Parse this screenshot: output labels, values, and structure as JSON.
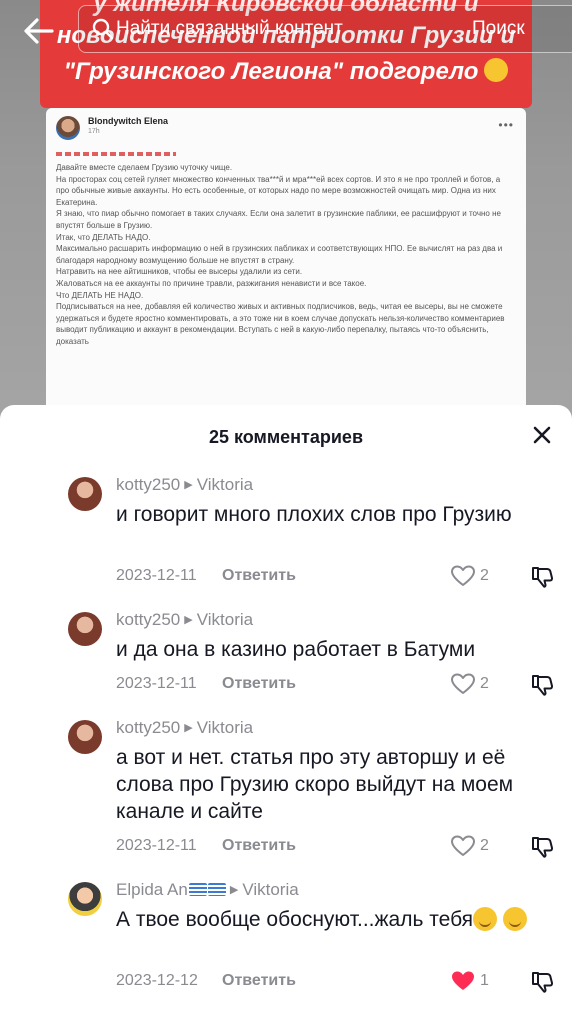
{
  "video": {
    "banner": {
      "line1": "у жителя Кировской области и",
      "line2": "новоиспеченной патриотки Грузии и",
      "line3": "\"Грузинского Легиона\" подгорело"
    },
    "post": {
      "author": "Blondywitch Elena",
      "time": "17h",
      "text": "Давайте вместе сделаем Грузию чуточку чище.\nНа просторах соц сетей гуляет множество конченных тва***й и мра***ей всех сортов. И это я не про троллей и ботов, а про обычные живые аккаунты. Но есть особенные, от которых надо по мере возможностей очищать мир. Одна из них Екатерина.\nЯ знаю, что пиар обычно помогает в таких случаях. Если она залетит в грузинские паблики, ее расшифруют и точно не впустят больше в Грузию.\nИтак, что ДЕЛАТЬ НАДО.\nМаксимально расшарить информацию о ней в грузинских пабликах и соответствующих НПО. Ее вычислят на раз два и благодаря народному возмущению больше не впустят в страну.\nНатравить на нее айтишников, чтобы ее высеры удалили из сети.\nЖаловаться на ее аккаунты по причине травли, разжигания ненависти и все такое.\nЧто ДЕЛАТЬ НЕ НАДО.\nПодписываться на нее, добавляя ей количество живых и активных подписчиков, ведь, читая ее высеры, вы не сможете удержаться и будете яростно комментировать, а это тоже ни в коем случае допускать нельзя-количество комментариев выводит публикацию и аккаунт в рекомендации. Вступать с ней в какую-либо перепалку, пытаясь что-то объяснить, доказать"
    }
  },
  "search": {
    "placeholder": "Найти связанный контент",
    "button": "Поиск"
  },
  "comments_sheet": {
    "title": "25 комментариев",
    "reply_label": "Ответить",
    "comments": [
      {
        "user": "kotty250",
        "reply_to": "Viktoria",
        "text": "и говорит много плохих слов про Грузию",
        "date": "2023-12-11",
        "likes": "2",
        "liked": false
      },
      {
        "user": "kotty250",
        "reply_to": "Viktoria",
        "text": "и да она в казино работает в Батуми",
        "date": "2023-12-11",
        "likes": "2",
        "liked": false
      },
      {
        "user": "kotty250",
        "reply_to": "Viktoria",
        "text": "а вот и нет. статья про эту авторшу и её слова про Грузию скоро выйдут на моем канале и сайте",
        "date": "2023-12-11",
        "likes": "2",
        "liked": false
      },
      {
        "user": "Elpida An",
        "reply_to": "Viktoria",
        "text": "А твое вообще обоснуют...жаль тебя",
        "date": "2023-12-12",
        "likes": "1",
        "liked": true
      }
    ]
  },
  "colors": {
    "banner_red": "#e53a3a",
    "like_red": "#fe2c55",
    "muted_gray": "#8a8b91",
    "text_dark": "#161823"
  }
}
